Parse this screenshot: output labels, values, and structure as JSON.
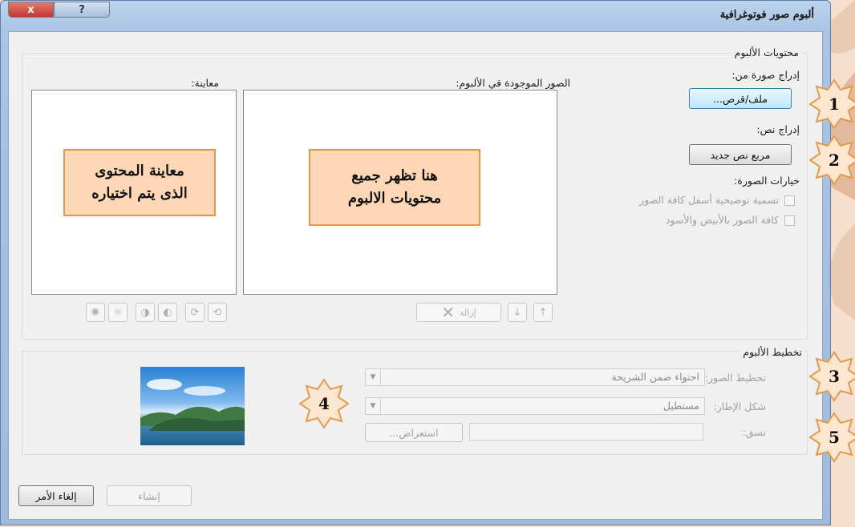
{
  "window": {
    "title": "ألبوم صور فوتوغرافية",
    "close_glyph": "x",
    "help_glyph": "?"
  },
  "album_content": {
    "group_label": "محتويات الألبوم",
    "insert_picture_label": "إدراج صورة من:",
    "file_disk_button": "ملف/قرص...",
    "insert_text_label": "إدراج نص:",
    "new_text_box_button": "مربع نص جديد",
    "picture_options_label": "خيارات الصورة:",
    "caption_option": "تسمية توضيحية أسفل كافة الصور",
    "black_white_option": "كافة الصور بالأبيض والأسود",
    "pictures_in_album_label": "الصور الموجودة في الألبوم:",
    "preview_label": "معاينة:",
    "remove_button": "إزالة"
  },
  "album_layout": {
    "group_label": "تخطيط الألبوم",
    "picture_layout_label": "تخطيط الصور:",
    "picture_layout_value": "احتواء ضمن الشريحة",
    "frame_shape_label": "شكل الإطار:",
    "frame_shape_value": "مستطيل",
    "theme_label": "نسق:",
    "browse_button": "استعراض..."
  },
  "footer": {
    "create_button": "إنشاء",
    "cancel_button": "إلغاء الأمر"
  },
  "callouts": {
    "album_list_note": "هنا تظهر جميع\nمحتويات الالبوم",
    "preview_note": "معاينة المحتوى\nالذى يتم اختياره"
  },
  "markers": [
    "1",
    "2",
    "3",
    "4",
    "5"
  ],
  "colors": {
    "callout_fill": "#fdd7b6",
    "callout_border": "#e49a4d",
    "marker_fill": "#fde6cf",
    "close_button": "#c94a3c",
    "window_frame": "#a9c4e4"
  }
}
